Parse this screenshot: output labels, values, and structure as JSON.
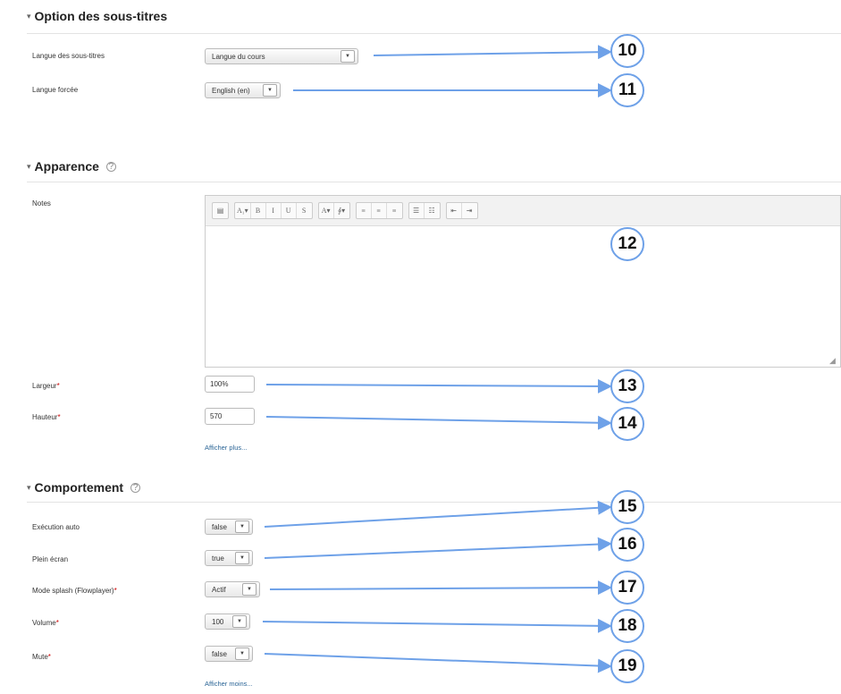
{
  "sections": {
    "subtitles": {
      "title": "Option des sous-titres"
    },
    "appearance": {
      "title": "Apparence"
    },
    "behavior": {
      "title": "Comportement"
    }
  },
  "fields": {
    "subtitle_language": {
      "label": "Langue des sous-titres",
      "value": "Langue du cours"
    },
    "forced_language": {
      "label": "Langue forcée",
      "value": "English (en)"
    },
    "notes": {
      "label": "Notes"
    },
    "width": {
      "label": "Largeur",
      "required_mark": "*",
      "value": "100%"
    },
    "height": {
      "label": "Hauteur",
      "required_mark": "*",
      "value": "570"
    },
    "autoplay": {
      "label": "Exécution auto",
      "value": "false"
    },
    "fullscreen": {
      "label": "Plein écran",
      "value": "true"
    },
    "splash": {
      "label": "Mode splash (Flowplayer)",
      "required_mark": "*",
      "value": "Actif"
    },
    "volume": {
      "label": "Volume",
      "required_mark": "*",
      "value": "100"
    },
    "mute": {
      "label": "Mute",
      "required_mark": "*",
      "value": "false"
    }
  },
  "links": {
    "show_more": "Afficher plus...",
    "show_less": "Afficher moins..."
  },
  "toolbar": {
    "groups": [
      [
        "▤"
      ],
      [
        "A₁▾",
        "B",
        "I",
        "U",
        "S"
      ],
      [
        "A▾",
        "∮▾"
      ],
      [
        "≡",
        "≡",
        "≡"
      ],
      [
        "☰",
        "☷"
      ],
      [
        "⇤",
        "⇥"
      ]
    ]
  },
  "callouts": [
    "10",
    "11",
    "12",
    "13",
    "14",
    "15",
    "16",
    "17",
    "18",
    "19"
  ],
  "colors": {
    "accent": "#6ea1e8",
    "required": "#cc0000",
    "link": "#2a6496"
  }
}
